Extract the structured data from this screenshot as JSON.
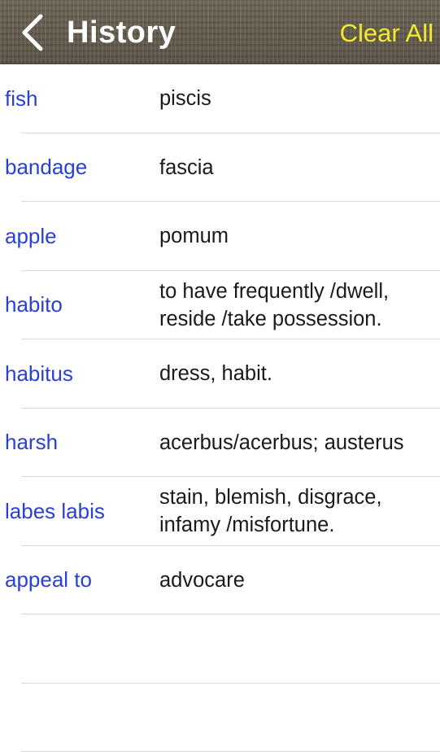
{
  "navbar": {
    "title": "History",
    "back_icon": "chevron-left-icon",
    "clear_label": "Clear All",
    "clear_color": "#f4ea2a"
  },
  "history": [
    {
      "word": "fish",
      "definition": "piscis"
    },
    {
      "word": "bandage",
      "definition": "fascia"
    },
    {
      "word": "apple",
      "definition": "pomum"
    },
    {
      "word": "habito",
      "definition": "to have frequently /dwell, reside /take possession."
    },
    {
      "word": "habitus",
      "definition": "dress, habit."
    },
    {
      "word": "harsh",
      "definition": "acerbus/acerbus; austerus"
    },
    {
      "word": "labes labis",
      "definition": "stain, blemish, disgrace, infamy /misfortune."
    },
    {
      "word": "appeal to",
      "definition": "advocare"
    },
    {
      "word": "",
      "definition": ""
    },
    {
      "word": "",
      "definition": ""
    }
  ],
  "colors": {
    "word": "#2a3fd6",
    "definition": "#1a1a1a",
    "separator": "#d8d8d8"
  }
}
